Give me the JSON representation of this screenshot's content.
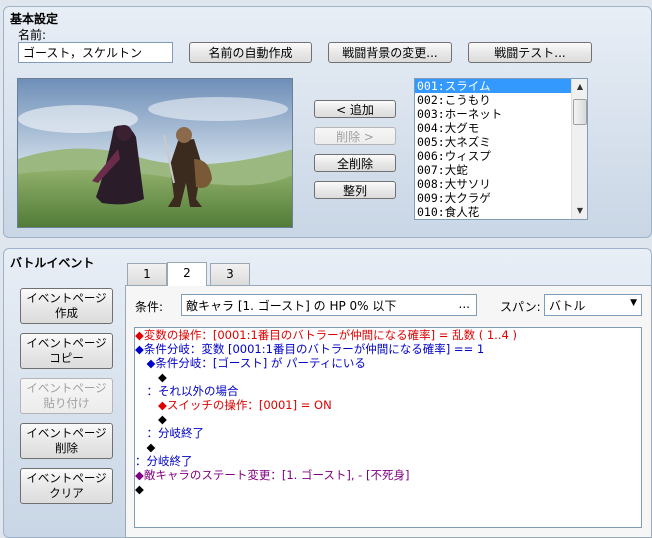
{
  "basic": {
    "title": "基本設定",
    "name_label": "名前:",
    "name_value": "ゴースト，スケルトン",
    "auto_name_button": "名前の自動作成",
    "change_bg_button": "戦闘背景の変更...",
    "battle_test_button": "戦闘テスト..."
  },
  "members": {
    "add_button": "< 追加",
    "remove_button": "削除 >",
    "remove_all_button": "全削除",
    "arrange_button": "整列"
  },
  "enemy_list": [
    "001:スライム",
    "002:こうもり",
    "003:ホーネット",
    "004:大グモ",
    "005:大ネズミ",
    "006:ウィスプ",
    "007:大蛇",
    "008:大サソリ",
    "009:大クラゲ",
    "010:食人花"
  ],
  "battle_event": {
    "title": "バトルイベント",
    "buttons": [
      {
        "line1": "イベントページ",
        "line2": "作成"
      },
      {
        "line1": "イベントページ",
        "line2": "コピー"
      },
      {
        "line1": "イベントページ",
        "line2": "貼り付け"
      },
      {
        "line1": "イベントページ",
        "line2": "削除"
      },
      {
        "line1": "イベントページ",
        "line2": "クリア"
      }
    ],
    "tabs": [
      "1",
      "2",
      "3"
    ],
    "condition_label": "条件:",
    "condition_value": "敵キャラ [1. ゴースト] の HP 0% 以下",
    "condition_more": "...",
    "span_label": "スパン:",
    "span_value": "バトル",
    "commands": [
      {
        "text": "◆変数の操作：[0001:1番目のバトラーが仲間になる確率] = 乱数 ( 1..4 )",
        "color": "#e00000"
      },
      {
        "text": "◆条件分岐：変数 [0001:1番目のバトラーが仲間になる確率] == 1",
        "color": "#0000c8"
      },
      {
        "text": "　◆条件分岐：[ゴースト] が パーティにいる",
        "color": "#0000c8"
      },
      {
        "text": "　　◆",
        "color": "#000000"
      },
      {
        "text": "　：それ以外の場合",
        "color": "#0000c8"
      },
      {
        "text": "　　◆スイッチの操作：[0001] = ON",
        "color": "#e00000"
      },
      {
        "text": "　　◆",
        "color": "#000000"
      },
      {
        "text": "　：分岐終了",
        "color": "#0000c8"
      },
      {
        "text": "　◆",
        "color": "#000000"
      },
      {
        "text": "：分岐終了",
        "color": "#0000c8"
      },
      {
        "text": "◆敵キャラのステート変更：[1. ゴースト], - [不死身]",
        "color": "#800080"
      },
      {
        "text": "◆",
        "color": "#000000"
      }
    ]
  }
}
